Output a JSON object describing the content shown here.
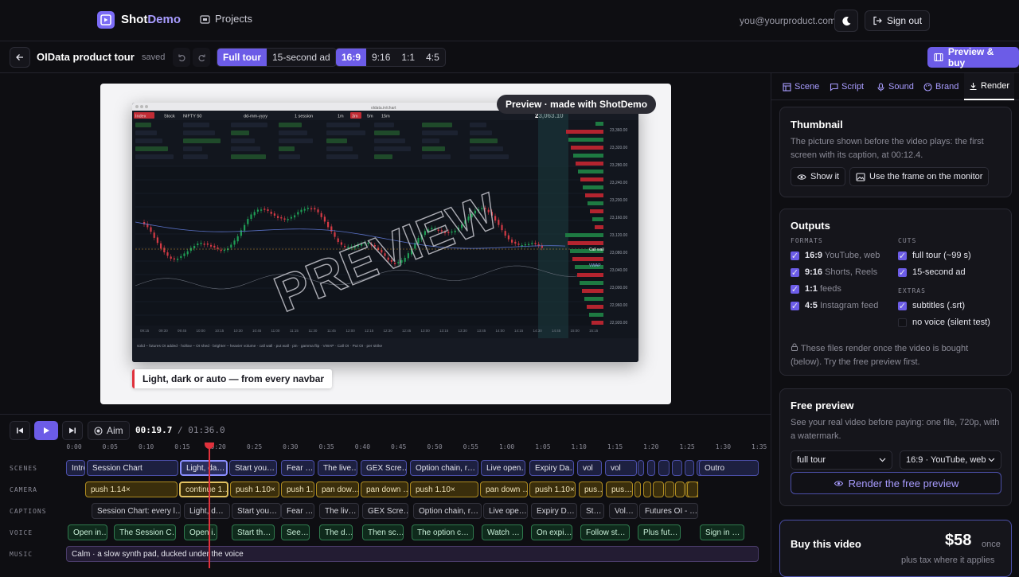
{
  "app": {
    "name_a": "Shot",
    "name_b": "Demo",
    "projects": "Projects",
    "email": "you@yourproduct.com",
    "signout": "Sign out"
  },
  "project": {
    "title": "OIData product tour",
    "status": "saved"
  },
  "cuts": [
    {
      "label": "Full tour",
      "on": true
    },
    {
      "label": "15-second ad",
      "on": false
    }
  ],
  "ratios": [
    {
      "label": "16:9",
      "on": true
    },
    {
      "label": "9:16",
      "on": false
    },
    {
      "label": "1:1",
      "on": false
    },
    {
      "label": "4:5",
      "on": false
    }
  ],
  "buy_button": "Preview & buy",
  "preview": {
    "badge": "Preview · made with ShotDemo",
    "watermark": "PREVIEW",
    "caption": "Light, dark or auto — from every navbar"
  },
  "monitor": {
    "tabs": [
      "Index",
      "Stock",
      "NIFTY 50",
      "dd-mm-yyyy",
      "1 session",
      "1m",
      "3m",
      "5m",
      "15m"
    ],
    "price": "23,063.10",
    "url": "oldata.in/chart",
    "right_ticks": [
      "23,360.00",
      "23,320.00",
      "23,280.00",
      "23,240.00",
      "23,200.00",
      "23,160.00",
      "23,120.00",
      "23,080.00",
      "23,040.00",
      "23,000.00",
      "22,960.00",
      "22,920.00"
    ],
    "time_ticks": [
      "09:15",
      "09:30",
      "09:45",
      "10:00",
      "10:15",
      "10:30",
      "10:45",
      "11:00",
      "11:15",
      "11:30",
      "11:45",
      "12:00",
      "12:15",
      "12:30",
      "12:45",
      "13:00",
      "13:15",
      "13:30",
      "13:45",
      "14:00",
      "14:15",
      "14:30",
      "14:45",
      "15:00",
      "15:15"
    ],
    "labels": {
      "call_wall": "Call wall",
      "put_wall": "Put wall",
      "vwap": "VWAP"
    },
    "legend": "solid – futures OI added · hollow – OI shed · brighter – heavier volume · call wall · put wall · pin · gamma flip · VWAP · Call OI · Put OI · per strike"
  },
  "timeline": {
    "aim": "Aim",
    "time_current": "00:19.7",
    "time_total": "01:36.0",
    "ruler": [
      "0:00",
      "0:05",
      "0:10",
      "0:15",
      "0:20",
      "0:25",
      "0:30",
      "0:35",
      "0:40",
      "0:45",
      "0:50",
      "0:55",
      "1:00",
      "1:05",
      "1:10",
      "1:15",
      "1:20",
      "1:25",
      "1:30",
      "1:35"
    ],
    "labels": {
      "scenes": "SCENES",
      "camera": "CAMERA",
      "captions": "CAPTIONS",
      "voice": "VOICE",
      "music": "MUSIC"
    },
    "scenes": [
      "Intro",
      "Session Chart",
      "Light, da…",
      "Start you…",
      "Fear …",
      "The live…",
      "GEX Scre…",
      "Option chain, r…",
      "Live open…",
      "Expiry Da…",
      "vol",
      "vol",
      "",
      "",
      "",
      "",
      "",
      "",
      "",
      "Outro"
    ],
    "camera": [
      "push 1.14×",
      "continue 1…",
      "push 1.10×",
      "push 1…",
      "pan dow…",
      "pan down …",
      "push 1.10×",
      "pan down …",
      "push 1.10×",
      "pus…",
      "pus…",
      "",
      "",
      "",
      "",
      "",
      "",
      "",
      ""
    ],
    "captions": [
      "Session Chart: every l…",
      "Light, d…",
      "Start you…",
      "Fear …",
      "The liv…",
      "GEX Scre…",
      "Option chain, r…",
      "Live ope…",
      "Expiry D…",
      "St…",
      "Vol…",
      "Futures OI - …"
    ],
    "voice": [
      "Open in…",
      "The Session C…",
      "Open i…",
      "Start th…",
      "See…",
      "The d…",
      "Then sc…",
      "The option c…",
      "Watch …",
      "On expi…",
      "Follow st…",
      "Plus fut…",
      "Sign in …"
    ],
    "music": "Calm · a slow synth pad, ducked under the voice"
  },
  "panel": {
    "tabs": [
      "Scene",
      "Script",
      "Sound",
      "Brand",
      "Render"
    ],
    "thumbnail": {
      "title": "Thumbnail",
      "desc": "The picture shown before the video plays: the first screen with its caption, at 00:12.4.",
      "show": "Show it",
      "use": "Use the frame on the monitor"
    },
    "outputs": {
      "title": "Outputs",
      "formats_label": "FORMATS",
      "cuts_label": "CUTS",
      "extras_label": "EXTRAS",
      "formats": [
        {
          "ratio": "16:9",
          "sub": "YouTube, web"
        },
        {
          "ratio": "9:16",
          "sub": "Shorts, Reels"
        },
        {
          "ratio": "1:1",
          "sub": "feeds"
        },
        {
          "ratio": "4:5",
          "sub": "Instagram feed"
        }
      ],
      "cuts": [
        "full tour (~99 s)",
        "15-second ad"
      ],
      "extras": [
        {
          "label": "subtitles (.srt)",
          "on": true
        },
        {
          "label": "no voice (silent test)",
          "on": false
        }
      ],
      "note": "These files render once the video is bought (below). Try the free preview first."
    },
    "free_preview": {
      "title": "Free preview",
      "desc": "See your real video before paying: one file, 720p, with a watermark.",
      "cut": "full tour",
      "format": "16:9 · YouTube, web",
      "button": "Render the free preview"
    },
    "buy": {
      "title": "Buy this video",
      "price": "$58",
      "once": "once",
      "tax": "plus tax where it applies"
    }
  }
}
